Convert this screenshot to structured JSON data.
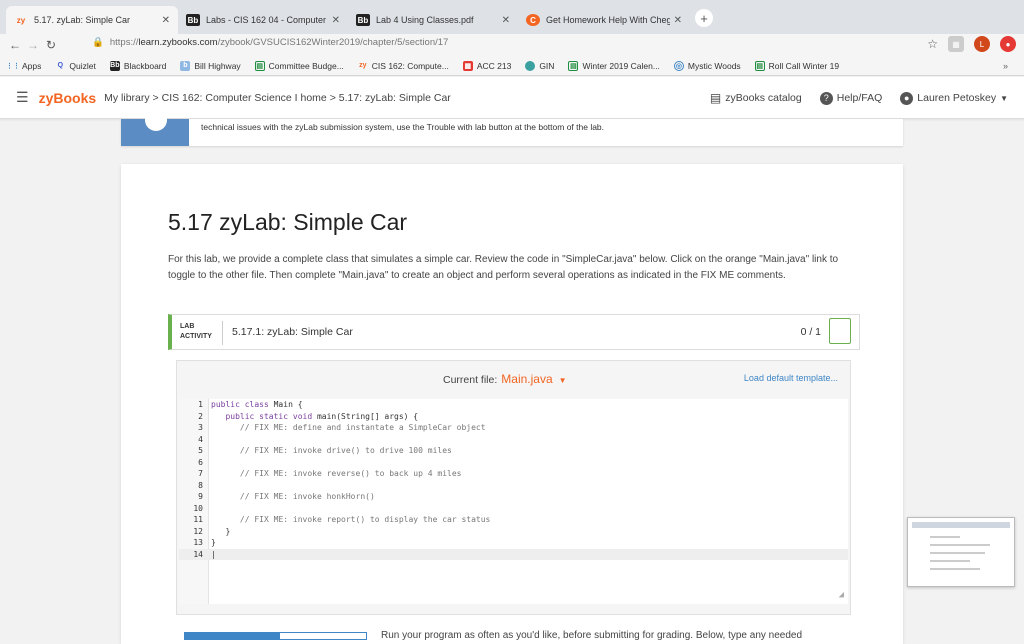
{
  "browser": {
    "tabs": [
      {
        "icon": "zy",
        "title": "5.17. zyLab: Simple Car",
        "active": true
      },
      {
        "icon": "Bb",
        "title": "Labs - CIS 162 04 - Computer"
      },
      {
        "icon": "Bb",
        "title": "Lab 4 Using Classes.pdf"
      },
      {
        "icon": "C",
        "title": "Get Homework Help With Cheg"
      }
    ],
    "url_prefix": "https://",
    "url_host": "learn.zybooks.com",
    "url_path": "/zybook/GVSUCIS162Winter2019/chapter/5/section/17",
    "bookmarks": [
      {
        "icon": "apps-icon",
        "label": "Apps"
      },
      {
        "icon": "quizlet-icon",
        "label": "Quizlet"
      },
      {
        "icon": "blackboard-icon",
        "label": "Blackboard"
      },
      {
        "icon": "bill-icon",
        "label": "Bill Highway"
      },
      {
        "icon": "sheet-icon",
        "label": "Committee Budge..."
      },
      {
        "icon": "zy-icon",
        "label": "CIS 162: Compute..."
      },
      {
        "icon": "acc-icon",
        "label": "ACC 213"
      },
      {
        "icon": "gin-icon",
        "label": "GIN"
      },
      {
        "icon": "sheet-icon",
        "label": "Winter 2019 Calen..."
      },
      {
        "icon": "web-icon",
        "label": "Mystic Woods"
      },
      {
        "icon": "sheet-icon",
        "label": "Roll Call Winter 19"
      }
    ]
  },
  "header": {
    "brand": "zyBooks",
    "breadcrumb": "My library > CIS 162: Computer Science I home > 5.17: zyLab: Simple Car",
    "catalog": "zyBooks catalog",
    "help": "Help/FAQ",
    "user": "Lauren Petoskey"
  },
  "notice": {
    "text": "technical issues with the zyLab submission system, use the Trouble with lab button at the bottom of the lab."
  },
  "main": {
    "title": "5.17 zyLab: Simple Car",
    "description": "For this lab, we provide a complete class that simulates a simple car. Review the code in \"SimpleCar.java\" below. Click on the orange \"Main.java\" link to toggle to the other file. Then complete \"Main.java\" to create an object and perform several operations as indicated in the FIX ME comments.",
    "lab": {
      "tag_line1": "LAB",
      "tag_line2": "ACTIVITY",
      "title": "5.17.1: zyLab: Simple Car",
      "score": "0 / 1"
    },
    "editor": {
      "current_file_label": "Current file:",
      "current_file": "Main.java",
      "load_template": "Load default template..."
    },
    "bottom_text": "Run your program as often as you'd like, before submitting for grading. Below, type any needed"
  },
  "colors": {
    "brand": "#f26522",
    "link": "#3f86c6",
    "lab_accent": "#6ab04c",
    "notice_band": "#5b8cc4"
  }
}
